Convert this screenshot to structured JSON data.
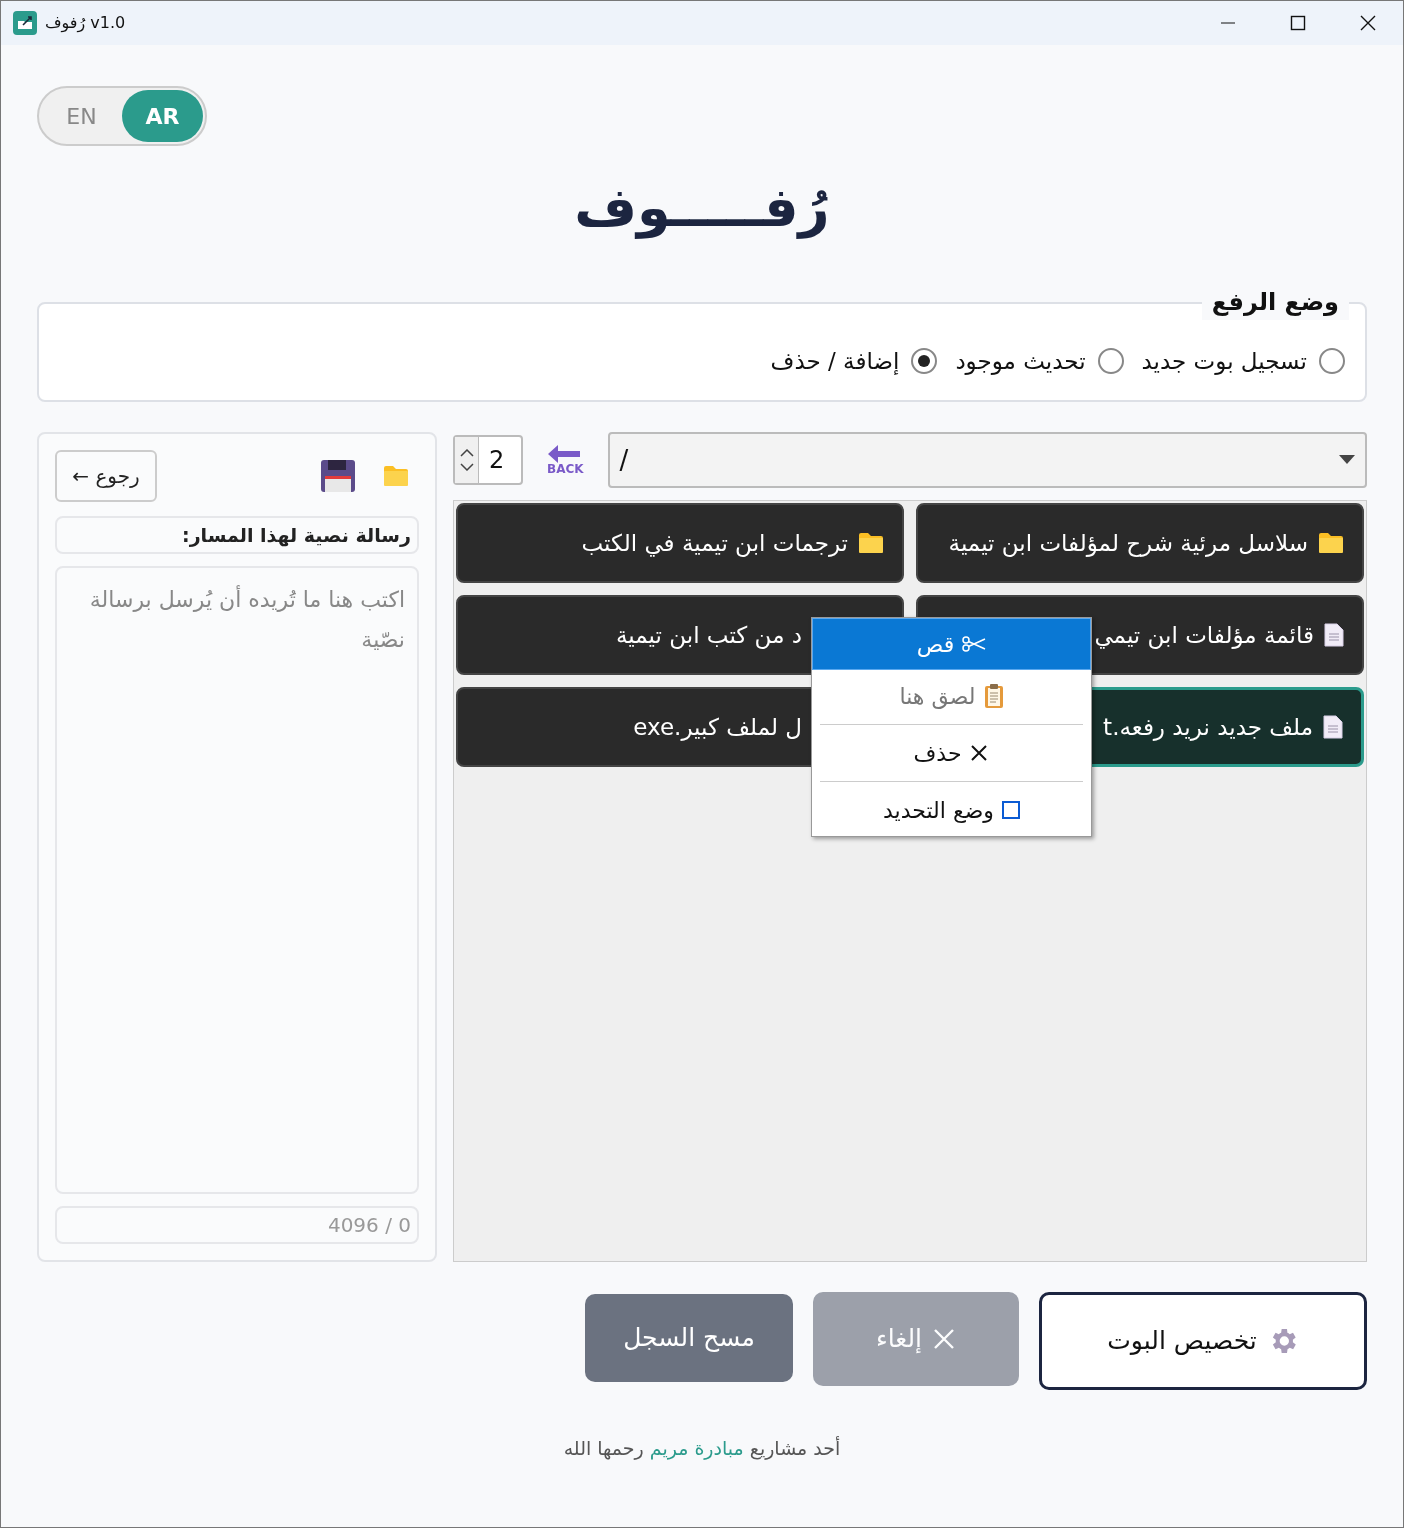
{
  "window": {
    "title": "رُفوف v1.0"
  },
  "language_toggle": [
    {
      "label": "AR",
      "selected": true
    },
    {
      "label": "EN",
      "selected": false
    }
  ],
  "app_title": "رُفـــــوف",
  "upload_mode": {
    "title": "وضع الرفع",
    "options": [
      {
        "label": "تسجيل بوت جديد",
        "selected": false
      },
      {
        "label": "تحديث موجود",
        "selected": false
      },
      {
        "label": "إضافة / حذف",
        "selected": true
      }
    ]
  },
  "side_panel": {
    "back_button": "رجوع ←",
    "message_label": "رسالة نصية لهذا المسار:",
    "message_placeholder": "اكتب هنا ما تُريده أن يُرسل برسالة نصّية",
    "counter": "0 / 4096"
  },
  "browser": {
    "columns_value": "2",
    "path": "/",
    "back_label": "BACK",
    "items": [
      {
        "kind": "folder",
        "label": "سلاسل مرئية شرح لمؤلفات ابن تيمية",
        "selected": false
      },
      {
        "kind": "folder",
        "label": "ترجمات ابن تيمية في الكتب",
        "selected": false
      },
      {
        "kind": "file",
        "label": "قائمة مؤلفات ابن تيمي",
        "selected": false
      },
      {
        "kind": "file",
        "label": "د من كتب ابن تيمية",
        "selected": false
      },
      {
        "kind": "file",
        "label": "ملف جديد نريد رفعه.t",
        "selected": true
      },
      {
        "kind": "file",
        "label": "ل لملف كبير.exe",
        "selected": false
      }
    ]
  },
  "context_menu": [
    {
      "kind": "cut",
      "label": "قص",
      "selected": true,
      "disabled": false
    },
    {
      "kind": "paste",
      "label": "لصق هنا",
      "selected": false,
      "disabled": true
    },
    {
      "kind": "delete",
      "label": "حذف",
      "selected": false,
      "disabled": false
    },
    {
      "kind": "select_mode",
      "label": "وضع التحديد",
      "selected": false,
      "disabled": false,
      "checked": false
    }
  ],
  "buttons": [
    {
      "kind": "customize",
      "label": "تخصيص البوت",
      "disabled": false
    },
    {
      "kind": "cancel",
      "label": "إلغاء",
      "disabled": true
    },
    {
      "kind": "clear",
      "label": "مسح السجل",
      "disabled": false
    }
  ],
  "footer": {
    "before": "أحد مشاريع",
    "link": "مبادرة مريم",
    "after": "رحمها الله"
  }
}
